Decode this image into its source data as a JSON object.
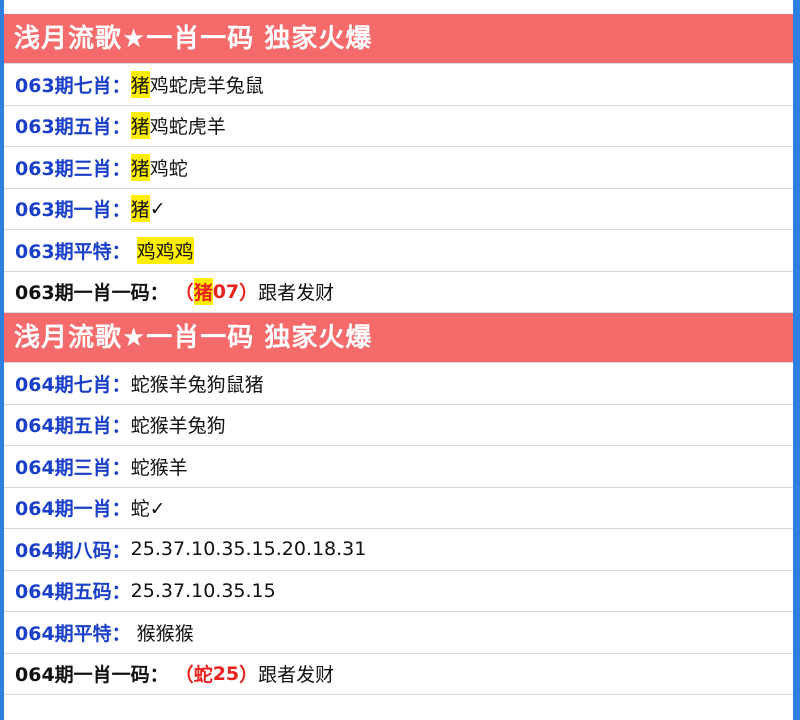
{
  "sections": [
    {
      "header": "浅月流歌★一肖一码 独家火爆",
      "rows": [
        {
          "label": "063期七肖：",
          "first": "猪",
          "rest": "鸡蛇虎羊兔鼠"
        },
        {
          "label": "063期五肖：",
          "first": "猪",
          "rest": "鸡蛇虎羊"
        },
        {
          "label": "063期三肖：",
          "first": "猪",
          "rest": "鸡蛇"
        },
        {
          "label": "063期一肖：",
          "first": "猪",
          "rest": "✓"
        },
        {
          "label": "063期平特：",
          "first": "鸡鸡鸡",
          "rest": ""
        }
      ],
      "special": {
        "label": "063期一肖一码：",
        "open": "（",
        "zodiac": "猪",
        "code": "07",
        "close": "）",
        "tail": "跟者发财"
      }
    },
    {
      "header": "浅月流歌★一肖一码 独家火爆",
      "rows": [
        {
          "label": "064期七肖：",
          "value": "蛇猴羊兔狗鼠猪"
        },
        {
          "label": "064期五肖：",
          "value": "蛇猴羊兔狗"
        },
        {
          "label": "064期三肖：",
          "value": "蛇猴羊"
        },
        {
          "label": "064期一肖：",
          "value": "蛇✓"
        },
        {
          "label": "064期八码：",
          "value": "25.37.10.35.15.20.18.31"
        },
        {
          "label": "064期五码：",
          "value": "25.37.10.35.15"
        },
        {
          "label": "064期平特：",
          "value": "猴猴猴"
        }
      ],
      "special": {
        "label": "064期一肖一码：",
        "open": "（",
        "zodiac": "蛇",
        "code": "25",
        "close": "）",
        "tail": "跟者发财"
      }
    }
  ],
  "colors": {
    "outer_bg": "#2f7fe0",
    "header_bg": "#f56b6b",
    "label_blue": "#1a3fc8",
    "highlight": "#ffee00",
    "special_red": "#e8231f"
  }
}
